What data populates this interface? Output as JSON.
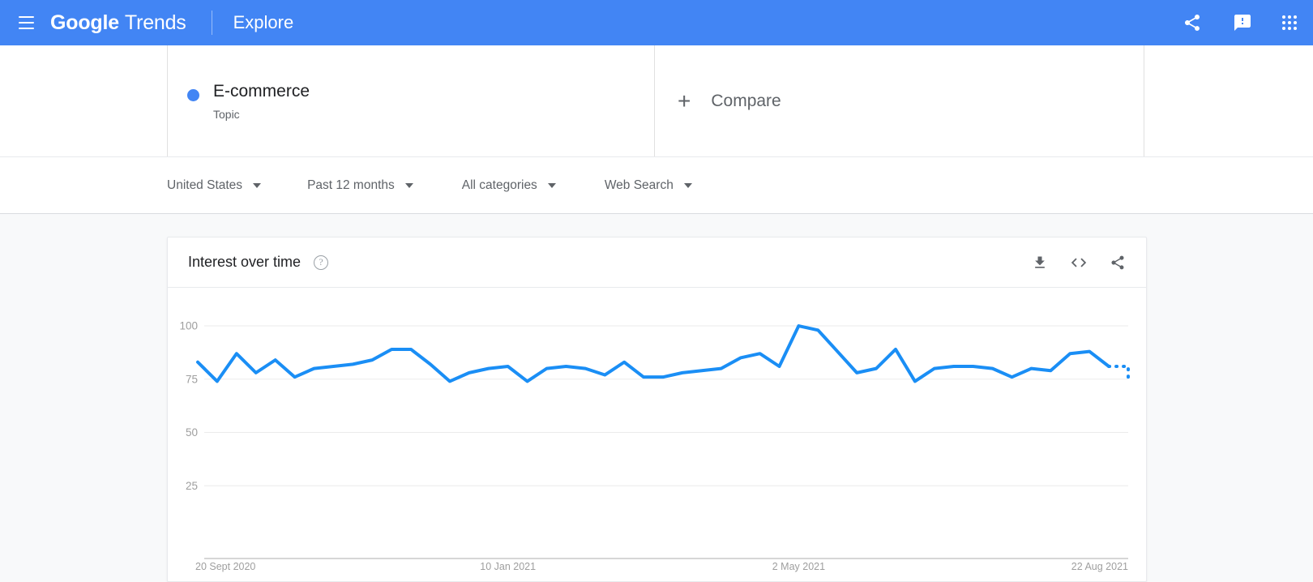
{
  "header": {
    "menu_icon": "hamburger-menu-icon",
    "brand_bold": "Google",
    "brand_light": "Trends",
    "section": "Explore",
    "icons": [
      {
        "name": "share-icon",
        "label": "Share"
      },
      {
        "name": "feedback-icon",
        "label": "Send feedback"
      },
      {
        "name": "apps-grid-icon",
        "label": "Google apps"
      }
    ],
    "bg_color": "#4285f4"
  },
  "query": {
    "term": {
      "title": "E-commerce",
      "subtitle": "Topic",
      "dot_color": "#4285f4"
    },
    "compare": {
      "plus": "+",
      "label": "Compare"
    }
  },
  "filters": [
    {
      "name": "region",
      "label": "United States"
    },
    {
      "name": "time-range",
      "label": "Past 12 months"
    },
    {
      "name": "category",
      "label": "All categories"
    },
    {
      "name": "search-type",
      "label": "Web Search"
    }
  ],
  "card": {
    "title": "Interest over time",
    "help_icon": "?",
    "actions": [
      {
        "name": "download-csv-icon",
        "label": "Download"
      },
      {
        "name": "embed-code-icon",
        "label": "Embed"
      },
      {
        "name": "share-chart-icon",
        "label": "Share"
      }
    ]
  },
  "chart_data": {
    "type": "line",
    "title": "Interest over time",
    "xlabel": "",
    "ylabel": "",
    "ylim": [
      0,
      108
    ],
    "yticks": [
      25,
      50,
      75,
      100
    ],
    "grid": true,
    "legend": null,
    "line_color": "#1a8ef5",
    "x_tick_labels": [
      "20 Sept 2020",
      "10 Jan 2021",
      "2 May 2021",
      "22 Aug 2021"
    ],
    "x_tick_indices": [
      0,
      16,
      31,
      47
    ],
    "series": [
      {
        "name": "E-commerce",
        "values": [
          83,
          74,
          87,
          78,
          84,
          76,
          80,
          81,
          82,
          84,
          89,
          89,
          82,
          74,
          78,
          80,
          81,
          74,
          80,
          81,
          80,
          77,
          83,
          76,
          76,
          78,
          79,
          80,
          85,
          87,
          81,
          100,
          98,
          88,
          78,
          80,
          89,
          74,
          80,
          81,
          81,
          80,
          76,
          80,
          79,
          87,
          88,
          81,
          74
        ],
        "dashed_tail_from_index": 47,
        "dashed_tail_values": [
          88,
          81,
          74
        ]
      }
    ],
    "note": "Final segment rendered as a dotted line indicating partial data."
  }
}
